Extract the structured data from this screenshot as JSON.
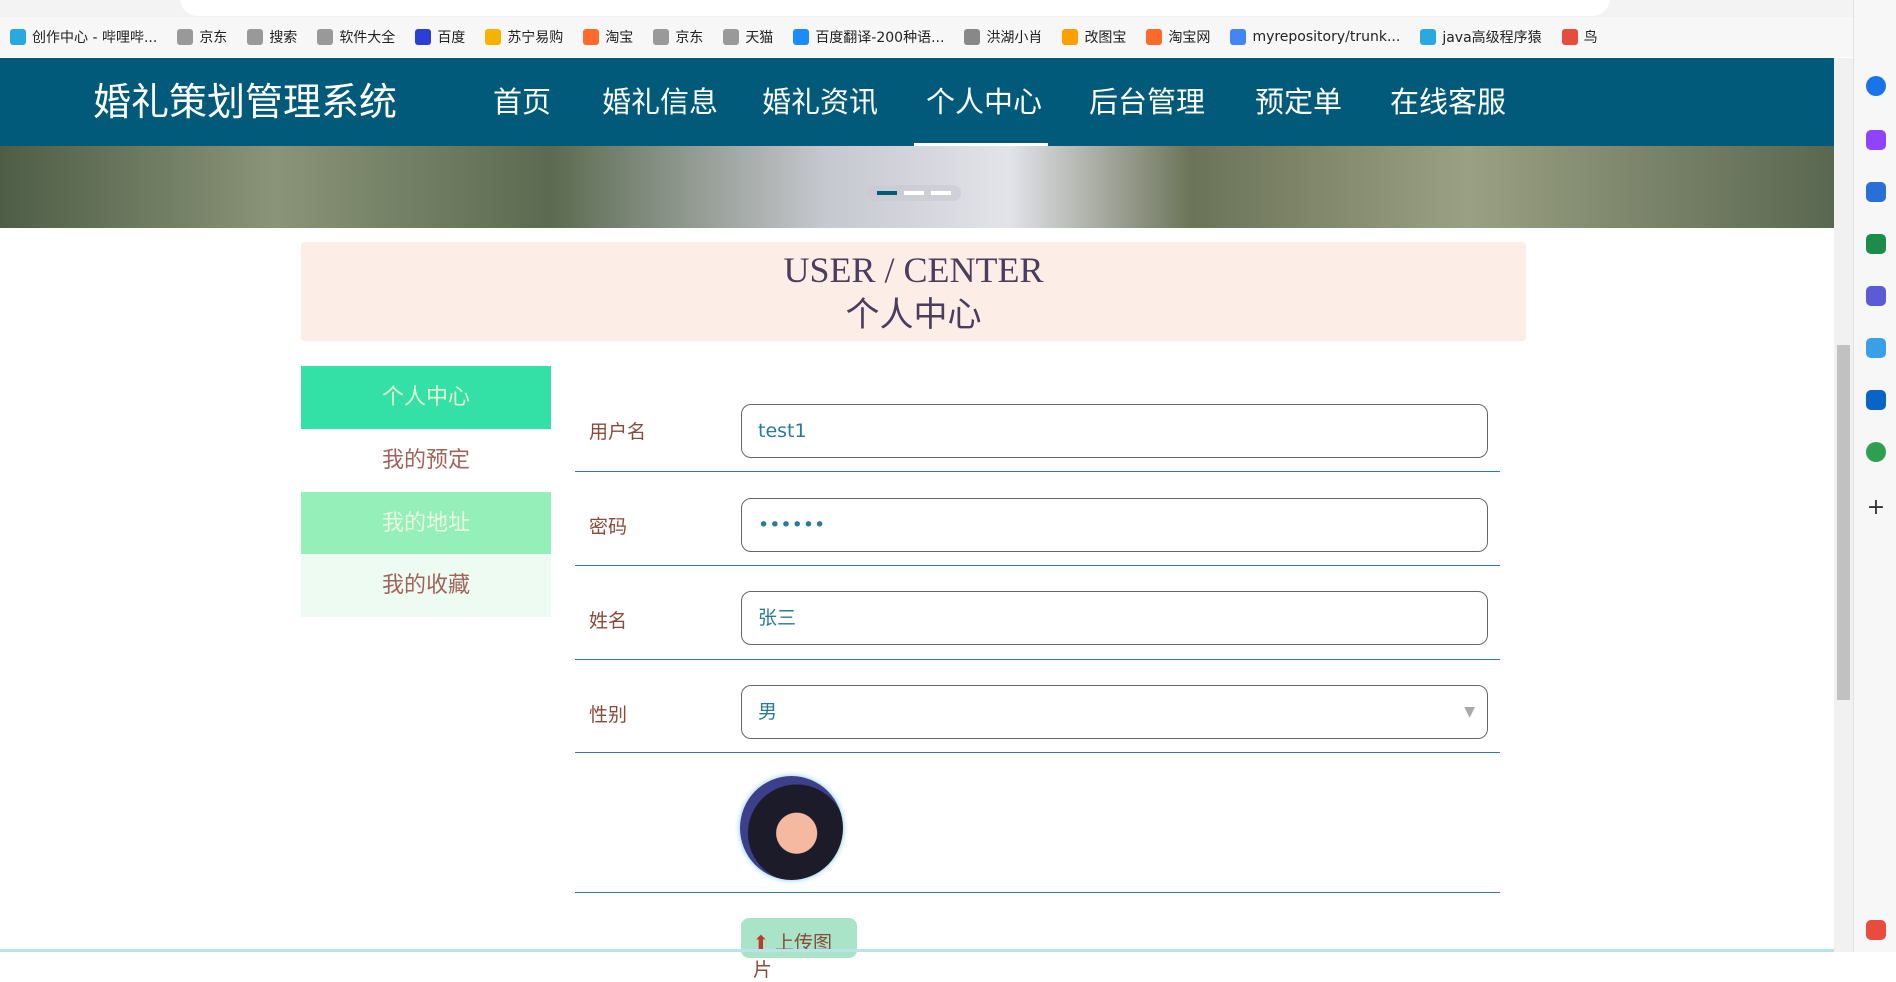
{
  "bookmarks": [
    "创作中心 - 哔哩哔...",
    "京东",
    "搜索",
    "软件大全",
    "百度",
    "苏宁易购",
    "淘宝",
    "京东",
    "天猫",
    "百度翻译-200种语...",
    "洪湖小肖",
    "改图宝",
    "淘宝网",
    "myrepository/trunk...",
    "java高级程序猿",
    "鸟"
  ],
  "brand": "婚礼策划管理系统",
  "nav": [
    "首页",
    "婚礼信息",
    "婚礼资讯",
    "个人中心",
    "后台管理",
    "预定单",
    "在线客服"
  ],
  "nav_active": "个人中心",
  "header": {
    "en": "USER / CENTER",
    "cn": "个人中心"
  },
  "menu": [
    "个人中心",
    "我的预定",
    "我的地址",
    "我的收藏"
  ],
  "form": {
    "username": {
      "label": "用户名",
      "value": "test1"
    },
    "password": {
      "label": "密码",
      "value": "••••••"
    },
    "name": {
      "label": "姓名",
      "value": "张三"
    },
    "gender": {
      "label": "性别",
      "value": "男"
    },
    "upload": "上传图片"
  },
  "colors": {
    "nav": "#025a7a",
    "menu_active": "#33e0a6",
    "menu_hover": "#94f0b8",
    "menu_light": "#edfbf3",
    "header_bg": "#fcede6"
  }
}
